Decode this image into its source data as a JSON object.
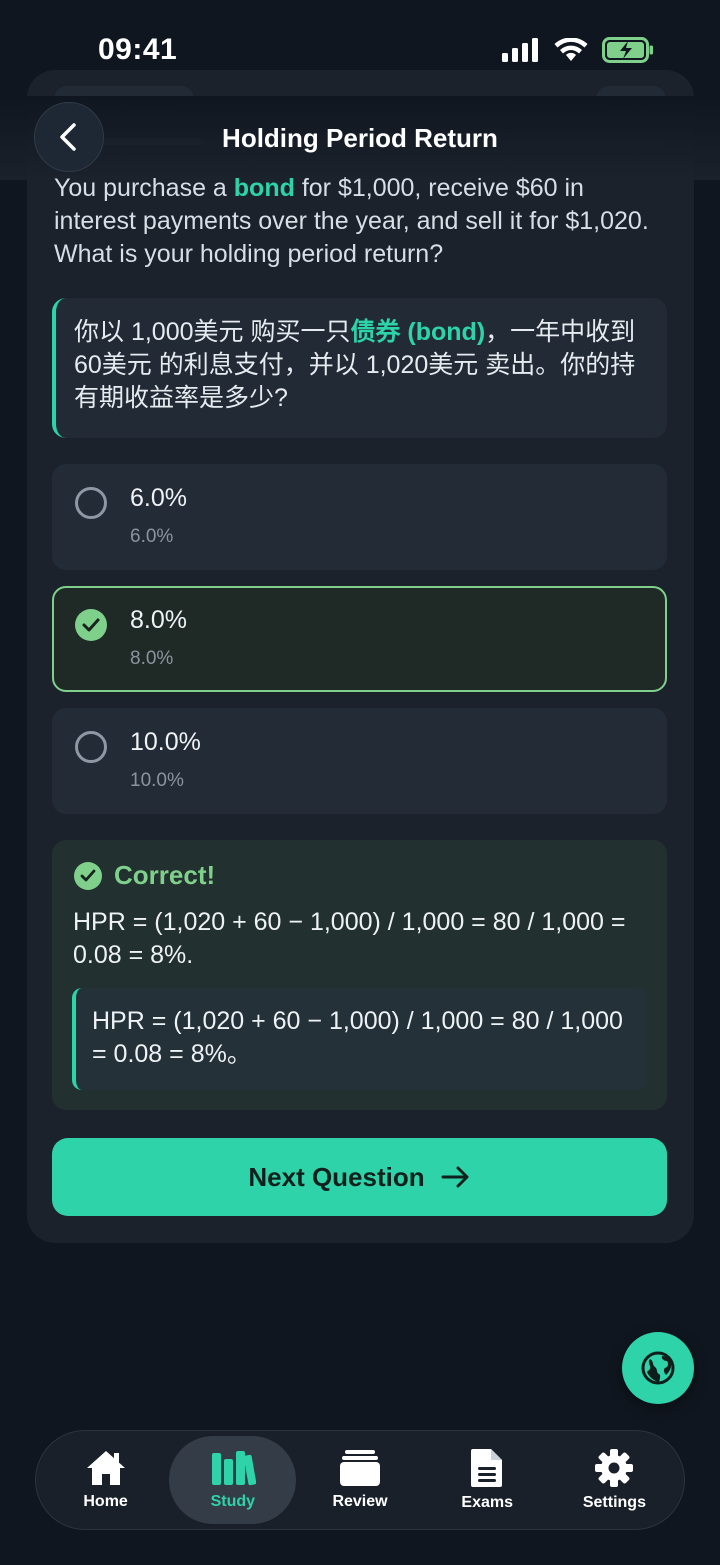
{
  "status_bar": {
    "time": "09:41"
  },
  "header": {
    "title": "Holding Period Return"
  },
  "question": {
    "en_before": "You purchase a ",
    "en_term": "bond",
    "en_after": " for $1,000, receive $60 in interest payments over the year, and sell it for $1,020. What is your holding period return?",
    "cn_before": "你以 1,000美元 购买一只",
    "cn_term": "债券 (bond)",
    "cn_after": "，一年中收到 60美元 的利息支付，并以 1,020美元 卖出。你的持有期收益率是多少?"
  },
  "options": [
    {
      "main": "6.0%",
      "sub": "6.0%",
      "selected": false
    },
    {
      "main": "8.0%",
      "sub": "8.0%",
      "selected": true
    },
    {
      "main": "10.0%",
      "sub": "10.0%",
      "selected": false
    }
  ],
  "feedback": {
    "title": "Correct!",
    "explanation": "HPR = (1,020 + 60 − 1,000) / 1,000 = 80 / 1,000 = 0.08 = 8%.",
    "explanation_cn": "HPR = (1,020 + 60 − 1,000) / 1,000 = 80 / 1,000 = 0.08 = 8%。"
  },
  "next_button": {
    "label": "Next Question"
  },
  "tabs": [
    {
      "label": "Home",
      "icon": "home-icon",
      "active": false
    },
    {
      "label": "Study",
      "icon": "books-icon",
      "active": true
    },
    {
      "label": "Review",
      "icon": "cards-icon",
      "active": false
    },
    {
      "label": "Exams",
      "icon": "document-icon",
      "active": false
    },
    {
      "label": "Settings",
      "icon": "gear-icon",
      "active": false
    }
  ],
  "colors": {
    "accent": "#2fd3a9",
    "correct": "#7fd08a",
    "background": "#10161f",
    "card": "#1b222c"
  }
}
